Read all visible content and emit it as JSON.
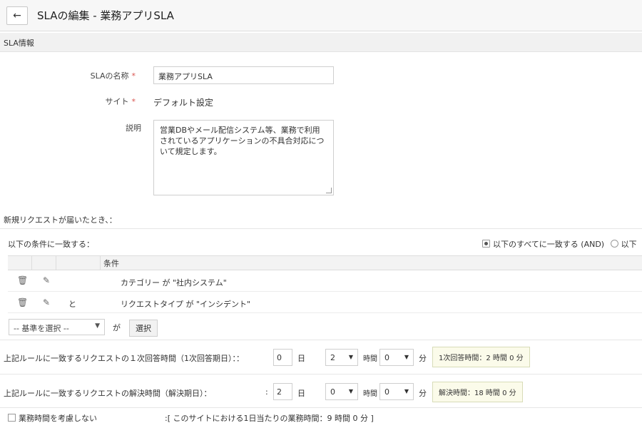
{
  "header": {
    "title": "SLAの編集 - 業務アプリSLA"
  },
  "section": {
    "label": "SLA情報"
  },
  "form": {
    "name_label": "SLAの名称",
    "name_value": "業務アプリSLA",
    "site_label": "サイト",
    "site_value": "デフォルト設定",
    "desc_label": "説明",
    "desc_value": "営業DBやメール配信システム等、業務で利用されているアプリケーションの不具合対応について規定します。",
    "required_mark": "*"
  },
  "rules": {
    "new_request_label": "新規リクエストが届いたとき、：",
    "match_label": "以下の条件に一致する：",
    "radio_all": "以下のすべてに一致する (AND)",
    "radio_any": "以下",
    "table_header": "条件",
    "rows": [
      {
        "conj": "",
        "condition": "カテゴリー が \"社内システム\""
      },
      {
        "conj": "と",
        "condition": "リクエストタイプ が \"インシデント\""
      }
    ],
    "criteria_select": "-- 基準を選択 --",
    "ga_label": "が",
    "select_button": "選択"
  },
  "response_time": {
    "label": "上記ルールに一致するリクエストの１次回答時間（1次回答期日）：：",
    "days": "0",
    "days_unit": "日",
    "hours": "2",
    "hours_unit": "時間",
    "minutes": "0",
    "minutes_unit": "分",
    "badge": "1次回答時間：2 時間 0 分"
  },
  "resolution_time": {
    "label": "上記ルールに一致するリクエストの解決時間（解決期日）：",
    "colon": ":",
    "days": "2",
    "days_unit": "日",
    "hours": "0",
    "hours_unit": "時間",
    "minutes": "0",
    "minutes_unit": "分",
    "badge": "解決時間：18 時間 0 分"
  },
  "footer": {
    "ignore_hours": "業務時間を考慮しない",
    "business_hours_note": ":[ このサイトにおける1日当たりの業務時間：9 時間 0 分 ]"
  },
  "icons": {
    "back": "arrow-left-icon",
    "delete": "trash-icon",
    "edit": "edit-icon"
  }
}
